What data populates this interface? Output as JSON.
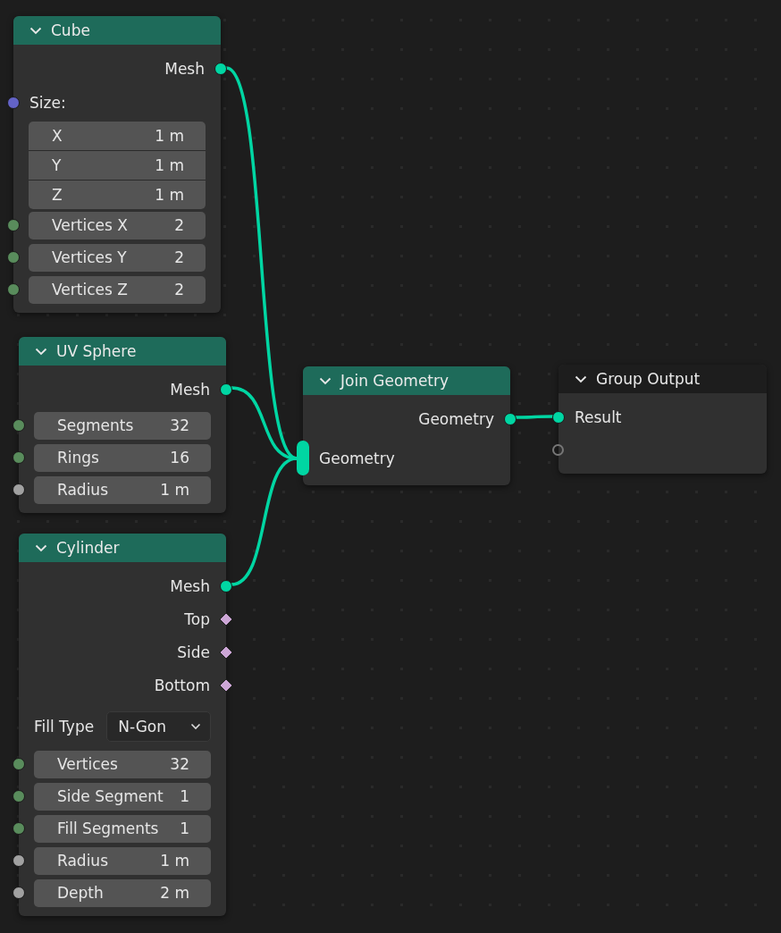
{
  "nodes": [
    {
      "title": "Cube",
      "kind": "geometry",
      "rows": [
        {
          "kind": "output",
          "label": "Mesh",
          "socket": {
            "kind": "circle",
            "color": "#00d6a3"
          }
        },
        {
          "kind": "label",
          "label": "Size:",
          "socket": {
            "kind": "circle",
            "color": "#6363c7"
          }
        },
        {
          "kind": "vector",
          "fields": [
            {
              "label": "X",
              "value": "1 m"
            },
            {
              "label": "Y",
              "value": "1 m"
            },
            {
              "label": "Z",
              "value": "1 m"
            }
          ]
        },
        {
          "kind": "field",
          "label": "Vertices X",
          "value": "2",
          "socket": {
            "kind": "circle",
            "color": "#598c5c"
          }
        },
        {
          "kind": "field",
          "label": "Vertices Y",
          "value": "2",
          "socket": {
            "kind": "circle",
            "color": "#598c5c"
          }
        },
        {
          "kind": "field",
          "label": "Vertices Z",
          "value": "2",
          "socket": {
            "kind": "circle",
            "color": "#598c5c"
          }
        }
      ]
    },
    {
      "title": "UV Sphere",
      "kind": "geometry",
      "rows": [
        {
          "kind": "output",
          "label": "Mesh",
          "socket": {
            "kind": "circle",
            "color": "#00d6a3"
          }
        },
        {
          "kind": "field",
          "label": "Segments",
          "value": "32",
          "socket": {
            "kind": "circle",
            "color": "#598c5c"
          }
        },
        {
          "kind": "field",
          "label": "Rings",
          "value": "16",
          "socket": {
            "kind": "circle",
            "color": "#598c5c"
          }
        },
        {
          "kind": "field",
          "label": "Radius",
          "value": "1 m",
          "socket": {
            "kind": "circle",
            "color": "#a1a1a1"
          }
        }
      ]
    },
    {
      "title": "Cylinder",
      "kind": "geometry",
      "rows": [
        {
          "kind": "output",
          "label": "Mesh",
          "socket": {
            "kind": "circle",
            "color": "#00d6a3"
          }
        },
        {
          "kind": "output",
          "label": "Top",
          "socket": {
            "kind": "diamond",
            "color": "#cca6d6"
          }
        },
        {
          "kind": "output",
          "label": "Side",
          "socket": {
            "kind": "diamond",
            "color": "#cca6d6"
          }
        },
        {
          "kind": "output",
          "label": "Bottom",
          "socket": {
            "kind": "diamond",
            "color": "#cca6d6"
          }
        },
        {
          "kind": "enum",
          "label": "Fill Type",
          "value": "N-Gon"
        },
        {
          "kind": "field",
          "label": "Vertices",
          "value": "32",
          "socket": {
            "kind": "circle",
            "color": "#598c5c"
          }
        },
        {
          "kind": "field",
          "label": "Side Segment",
          "value": "1",
          "socket": {
            "kind": "circle",
            "color": "#598c5c"
          }
        },
        {
          "kind": "field",
          "label": "Fill Segments",
          "value": "1",
          "socket": {
            "kind": "circle",
            "color": "#598c5c"
          }
        },
        {
          "kind": "field",
          "label": "Radius",
          "value": "1 m",
          "socket": {
            "kind": "circle",
            "color": "#a1a1a1"
          }
        },
        {
          "kind": "field",
          "label": "Depth",
          "value": "2 m",
          "socket": {
            "kind": "circle",
            "color": "#a1a1a1"
          }
        }
      ]
    },
    {
      "title": "Join Geometry",
      "kind": "geometry",
      "rows": [
        {
          "kind": "output",
          "label": "Geometry",
          "socket": {
            "kind": "circle",
            "color": "#00d6a3"
          }
        },
        {
          "kind": "input",
          "label": "Geometry",
          "socket": {
            "kind": "multi",
            "color": "#00d6a3"
          }
        }
      ]
    },
    {
      "title": "Group Output",
      "kind": "output",
      "rows": [
        {
          "kind": "input",
          "label": "Result",
          "socket": {
            "kind": "circle",
            "color": "#00d6a3"
          }
        },
        {
          "kind": "empty",
          "socket": {
            "kind": "hollow"
          }
        }
      ]
    }
  ]
}
